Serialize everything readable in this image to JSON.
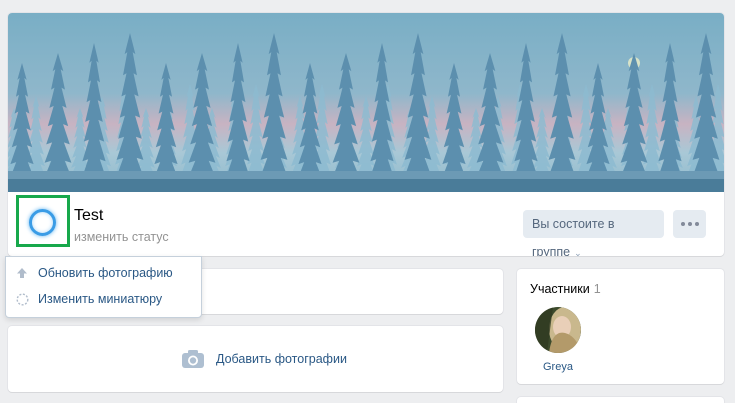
{
  "group": {
    "name": "Test",
    "status_link": "изменить статус",
    "membership_button": "Вы состоите в группе",
    "membership_chevron": "⌄"
  },
  "avatar_menu": {
    "items": [
      {
        "label": "Обновить фотографию",
        "icon": "upload-arrow-icon"
      },
      {
        "label": "Изменить миниатюру",
        "icon": "dashed-circle-icon"
      }
    ]
  },
  "photos": {
    "add_label": "Добавить фотографии",
    "icon": "camera-icon"
  },
  "members": {
    "title": "Участники",
    "count": "1",
    "list": [
      {
        "name": "Greya"
      }
    ]
  },
  "colors": {
    "accent_link": "#2a5885",
    "button_bg": "#e5ebf1",
    "avatar_highlight": "#17a84b",
    "page_bg": "#edeef0"
  }
}
